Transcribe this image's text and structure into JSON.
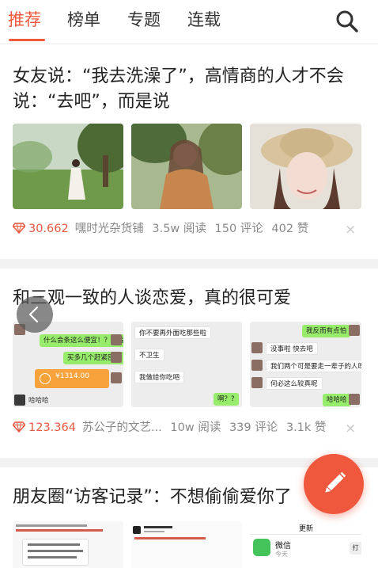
{
  "nav": {
    "tabs": [
      "推荐",
      "榜单",
      "专题",
      "连载"
    ],
    "active_index": 0,
    "accent": "#f0583e"
  },
  "articles": [
    {
      "title": "女友说：“我去洗澡了”，高情商的人才不会说：“去吧”，而是说",
      "score": "30.662",
      "source": "嘿时光杂货铺",
      "reads": "3.5w 阅读",
      "comments": "150 评论",
      "likes": "402 赞"
    },
    {
      "title": "和三观一致的人谈恋爱，真的很可爱",
      "score": "123.364",
      "source": "苏公子的文艺...",
      "reads": "10w 阅读",
      "comments": "339 评论",
      "likes": "3.1k 赞",
      "chat1": {
        "line1": "什么会条这么便宜！？😂😂",
        "line2": "买多几个赶紧囤着",
        "amount": "¥1314.00",
        "footer": "哈哈哈"
      },
      "chat2": {
        "line1": "你不要再外面吃那些啦",
        "line2": "不卫生",
        "line3": "我做给你吃吧",
        "line4": "啊？?"
      },
      "chat3": {
        "line1": "我反而有点怕",
        "line2": "没事啦 快去吧",
        "line3": "我们两个可是要走一辈子的人呀",
        "line4": "何必这么较真呢",
        "line5": "哈哈哈"
      }
    },
    {
      "title": "朋友圈“访客记录”：不想偷偷爱你了",
      "thumb3_header": "更新",
      "thumb3_app": "微信",
      "thumb3_time": "今天",
      "thumb3_button": "打"
    }
  ],
  "icons": {
    "search": "search-icon",
    "score": "diamond-icon",
    "close": "close-icon",
    "back": "chevron-left-icon",
    "fab": "pencil-icon"
  }
}
